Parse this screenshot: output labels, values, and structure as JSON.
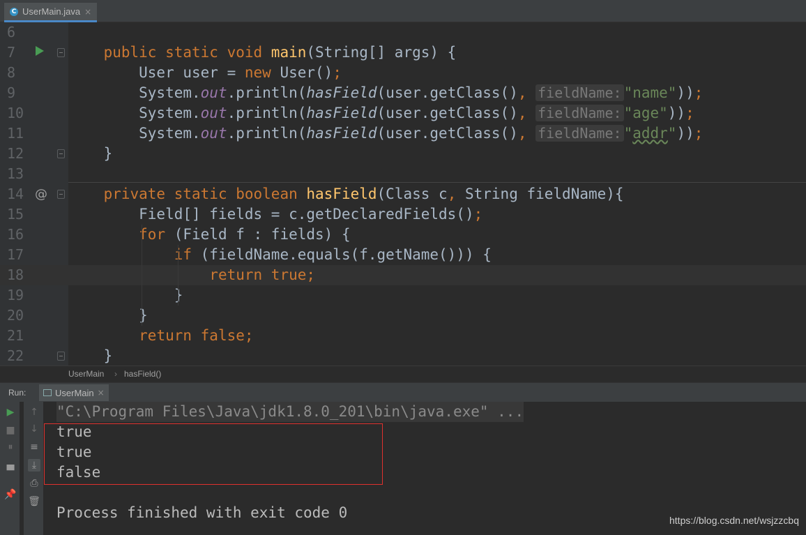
{
  "tab": {
    "icon": "C",
    "title": "UserMain.java",
    "close": "×"
  },
  "editor": {
    "line_numbers": [
      "6",
      "7",
      "8",
      "9",
      "10",
      "11",
      "12",
      "13",
      "14",
      "15",
      "16",
      "17",
      "18",
      "19",
      "20",
      "21",
      "22"
    ],
    "hint_label": "fieldName:",
    "current_line": "18"
  },
  "breadcrumb": {
    "items": [
      "UserMain",
      "hasField()"
    ],
    "separator": "›"
  },
  "run": {
    "label": "Run:",
    "tab_title": "UserMain",
    "close": "×"
  },
  "console": {
    "command": "\"C:\\Program Files\\Java\\jdk1.8.0_201\\bin\\java.exe\" ...",
    "output": [
      "true",
      "true",
      "false"
    ],
    "exit_message": "Process finished with exit code 0"
  },
  "watermark": "https://blog.csdn.net/wsjzzcbq"
}
